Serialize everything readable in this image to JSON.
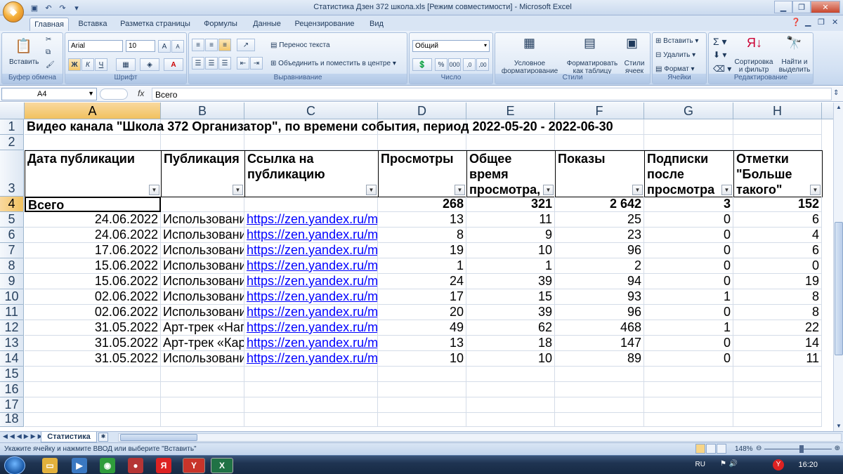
{
  "window": {
    "title": "Статистика Дзен 372 школа.xls  [Режим совместимости] - Microsoft Excel"
  },
  "tabs": [
    "Главная",
    "Вставка",
    "Разметка страницы",
    "Формулы",
    "Данные",
    "Рецензирование",
    "Вид"
  ],
  "ribbon": {
    "clipboard": {
      "paste": "Вставить",
      "label": "Буфер обмена"
    },
    "font": {
      "name": "Arial",
      "size": "10",
      "label": "Шрифт",
      "bold": "Ж",
      "italic": "К",
      "underline": "Ч"
    },
    "alignment": {
      "wrap": "Перенос текста",
      "merge": "Объединить и поместить в центре",
      "label": "Выравнивание"
    },
    "number": {
      "format": "Общий",
      "label": "Число",
      "percent": "%",
      "thousands": "000"
    },
    "styles": {
      "conditional": "Условное форматирование",
      "as_table": "Форматировать как таблицу",
      "cell_styles": "Стили ячеек",
      "label": "Стили"
    },
    "cells": {
      "insert": "Вставить",
      "delete": "Удалить",
      "format": "Формат",
      "label": "Ячейки"
    },
    "editing": {
      "sort": "Сортировка и фильтр",
      "find": "Найти и выделить",
      "label": "Редактирование"
    }
  },
  "formula_bar": {
    "name_box": "A4",
    "fx": "fx",
    "value": "Всего"
  },
  "sheet": {
    "columns": [
      "A",
      "B",
      "C",
      "D",
      "E",
      "F",
      "G",
      "H"
    ],
    "row_numbers": [
      "1",
      "2",
      "3",
      "4",
      "5",
      "6",
      "7",
      "8",
      "9",
      "10",
      "11",
      "12",
      "13",
      "14",
      "15",
      "16",
      "17",
      "18"
    ],
    "title": "Видео канала \"Школа 372 Организатор\", по времени события, период 2022-05-20 - 2022-06-30",
    "headers": [
      "Дата публикации",
      "Публикация",
      "Ссылка на публикацию",
      "Просмотры",
      "Общее время просмотра, мин.",
      "Показы",
      "Подписки после просмотра",
      "Отметки \"Больше такого\""
    ],
    "total": {
      "label": "Всего",
      "views": "268",
      "time": "321",
      "impressions": "2 642",
      "subs": "3",
      "likes": "152"
    },
    "rows": [
      {
        "date": "24.06.2022",
        "pub": "Использование",
        "link": "https://zen.yandex.ru/media",
        "views": "13",
        "time": "11",
        "impressions": "25",
        "subs": "0",
        "likes": "6"
      },
      {
        "date": "24.06.2022",
        "pub": "Использование",
        "link": "https://zen.yandex.ru/media",
        "views": "8",
        "time": "9",
        "impressions": "23",
        "subs": "0",
        "likes": "4"
      },
      {
        "date": "17.06.2022",
        "pub": "Использование",
        "link": "https://zen.yandex.ru/media",
        "views": "19",
        "time": "10",
        "impressions": "96",
        "subs": "0",
        "likes": "6"
      },
      {
        "date": "15.06.2022",
        "pub": "Использование",
        "link": "https://zen.yandex.ru/media",
        "views": "1",
        "time": "1",
        "impressions": "2",
        "subs": "0",
        "likes": "0"
      },
      {
        "date": "15.06.2022",
        "pub": "Использование",
        "link": "https://zen.yandex.ru/media",
        "views": "24",
        "time": "39",
        "impressions": "94",
        "subs": "0",
        "likes": "19"
      },
      {
        "date": "02.06.2022",
        "pub": "Использование",
        "link": "https://zen.yandex.ru/media",
        "views": "17",
        "time": "15",
        "impressions": "93",
        "subs": "1",
        "likes": "8"
      },
      {
        "date": "02.06.2022",
        "pub": "Использование",
        "link": "https://zen.yandex.ru/media",
        "views": "20",
        "time": "39",
        "impressions": "96",
        "subs": "0",
        "likes": "8"
      },
      {
        "date": "31.05.2022",
        "pub": "Арт-трек «Напр",
        "link": "https://zen.yandex.ru/media",
        "views": "49",
        "time": "62",
        "impressions": "468",
        "subs": "1",
        "likes": "22"
      },
      {
        "date": "31.05.2022",
        "pub": "Арт-трек «Карь",
        "link": "https://zen.yandex.ru/media",
        "views": "13",
        "time": "18",
        "impressions": "147",
        "subs": "0",
        "likes": "14"
      },
      {
        "date": "31.05.2022",
        "pub": "Использование",
        "link": "https://zen.yandex.ru/media",
        "views": "10",
        "time": "10",
        "impressions": "89",
        "subs": "0",
        "likes": "11"
      }
    ]
  },
  "sheet_tab": "Статистика",
  "status": {
    "text": "Укажите ячейку и нажмите ВВОД или выберите \"Вставить\"",
    "zoom": "148%"
  },
  "taskbar": {
    "lang": "RU",
    "time": "16:20"
  }
}
